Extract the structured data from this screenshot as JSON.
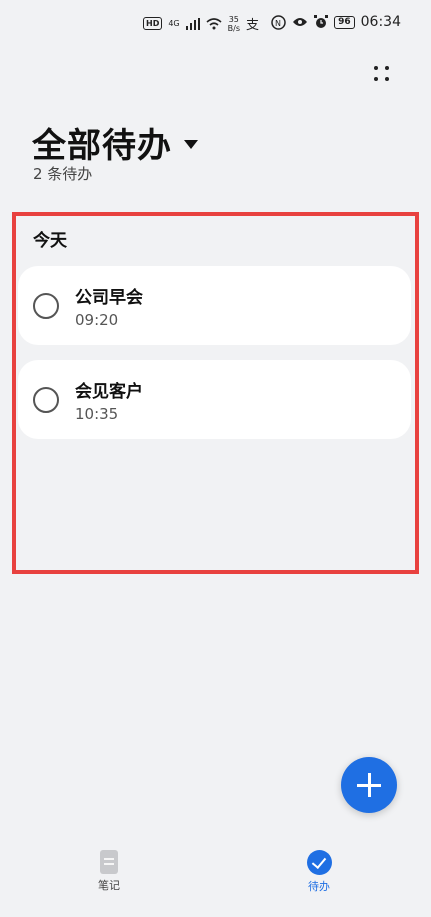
{
  "status_bar": {
    "hd": "HD",
    "network": "4G",
    "speed_value": "35",
    "speed_unit": "B/s",
    "time": "06:34",
    "battery": "96"
  },
  "header": {
    "title": "全部待办",
    "count_text": "2 条待办"
  },
  "section": {
    "label": "今天"
  },
  "todos": [
    {
      "name": "公司早会",
      "time": "09:20"
    },
    {
      "name": "会见客户",
      "time": "10:35"
    }
  ],
  "bottom_nav": {
    "notes_label": "笔记",
    "todo_label": "待办"
  },
  "colors": {
    "accent": "#1f6fe3",
    "highlight": "#e8413f",
    "background": "#f1f2f4"
  }
}
